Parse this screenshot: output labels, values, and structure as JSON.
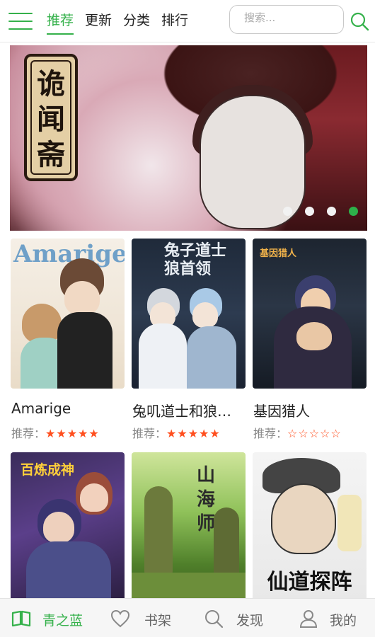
{
  "header": {
    "tabs": [
      {
        "label": "推荐",
        "active": true
      },
      {
        "label": "更新",
        "active": false
      },
      {
        "label": "分类",
        "active": false
      },
      {
        "label": "排行",
        "active": false
      }
    ],
    "search": {
      "placeholder": "搜索..."
    }
  },
  "banner": {
    "title": "诡闻斋",
    "slides_total": 4,
    "active_slide": 4
  },
  "books": [
    {
      "title": "Amarige",
      "rating_label": "推荐：",
      "rating_text": "★★★★★",
      "rating": 5
    },
    {
      "title": "兔叽道士和狼…",
      "rating_label": "推荐：",
      "rating_text": "★★★★★",
      "rating": 5
    },
    {
      "title": "基因猎人",
      "rating_label": "推荐：",
      "rating_text": "☆☆☆☆☆",
      "rating": 0
    },
    {
      "title": "",
      "cover_text": "百炼成神",
      "rating_label": "",
      "rating_text": ""
    },
    {
      "title": "",
      "cover_text": "山海师",
      "rating_label": "",
      "rating_text": ""
    },
    {
      "title": "",
      "cover_text": "仙道探阵",
      "rating_label": "",
      "rating_text": ""
    }
  ],
  "covers": {
    "amarige_text": "Amarige",
    "tuji_text": "兔子道士狼首领",
    "jiyin_text": "基因猎人"
  },
  "bottom_nav": [
    {
      "label": "青之蓝",
      "icon": "book-icon",
      "active": true
    },
    {
      "label": "书架",
      "icon": "heart-icon",
      "active": false
    },
    {
      "label": "发现",
      "icon": "search-icon",
      "active": false
    },
    {
      "label": "我的",
      "icon": "user-icon",
      "active": false
    }
  ],
  "colors": {
    "accent": "#35b14b",
    "star": "#ff4f1f"
  }
}
